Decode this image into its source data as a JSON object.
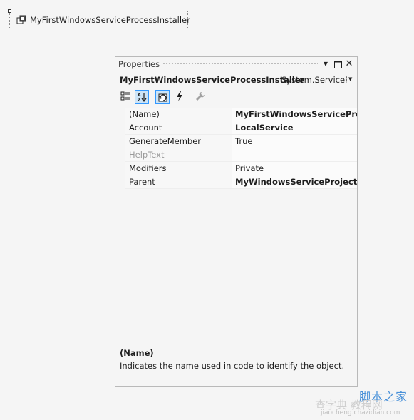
{
  "designer": {
    "component_label": "MyFirstWindowsServiceProcessInstaller",
    "component_icon": "installer-component-icon"
  },
  "properties": {
    "title": "Properties",
    "object_name": "MyFirstWindowsServiceProcessInstaller",
    "object_type": "System.ServicePr",
    "title_buttons": {
      "dropdown": "▼",
      "maximize": "□",
      "close": "✕"
    },
    "toolbar": {
      "categorized": "categorized-icon",
      "alphabetical": "alphabetical-sort-icon",
      "properties": "properties-icon",
      "events": "events-lightning-icon",
      "property_pages": "wrench-icon"
    },
    "rows": [
      {
        "name": "(Name)",
        "value": "MyFirstWindowsServiceProces",
        "bold": true,
        "disabled": false
      },
      {
        "name": "Account",
        "value": "LocalService",
        "bold": true,
        "disabled": false
      },
      {
        "name": "GenerateMember",
        "value": "True",
        "bold": false,
        "disabled": false
      },
      {
        "name": "HelpText",
        "value": "",
        "bold": false,
        "disabled": true
      },
      {
        "name": "Modifiers",
        "value": "Private",
        "bold": false,
        "disabled": false
      },
      {
        "name": "Parent",
        "value": "MyWindowsServiceProjectInst",
        "bold": true,
        "disabled": false
      }
    ],
    "description": {
      "title": "(Name)",
      "text": "Indicates the name used in code to identify the object."
    }
  },
  "watermark": {
    "line1": "脚本之家",
    "line2": "查字典 教程网",
    "line3": "jiaocheng.chazidian.com",
    "brand_color": "#2a7fd4"
  }
}
